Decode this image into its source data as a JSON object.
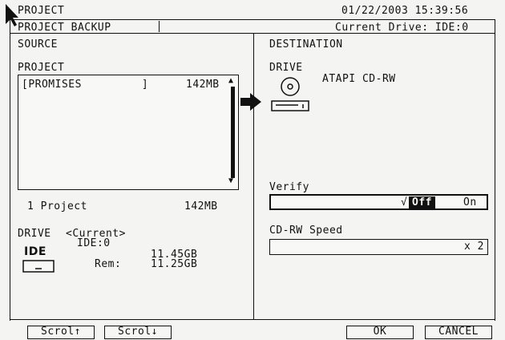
{
  "header": {
    "app_title": "PROJECT",
    "date_time": "01/22/2003 15:39:56",
    "screen_title": "PROJECT BACKUP",
    "current_drive": "Current Drive: IDE:0"
  },
  "source": {
    "heading": "SOURCE",
    "project_label": "PROJECT",
    "projects": [
      {
        "name": "[PROMISES         ]",
        "size": "142MB"
      }
    ],
    "count_label": "1 Project",
    "total_size": "142MB",
    "drive_label": "DRIVE",
    "drive_current": "<Current>",
    "drive_id": "IDE:0",
    "drive_icon_label": "IDE",
    "drive_capacity": "11.45GB",
    "rem_label": "Rem:",
    "rem_value": "11.25GB"
  },
  "destination": {
    "heading": "DESTINATION",
    "drive_label": "DRIVE",
    "drive_name": "ATAPI CD-RW",
    "verify_label": "Verify",
    "verify_check": "√",
    "verify_off": "Off",
    "verify_on": "On",
    "speed_label": "CD-RW Speed",
    "speed_value": "x 2"
  },
  "footer": {
    "scroll_up": "Scrol↑",
    "scroll_down": "Scrol↓",
    "ok": "OK",
    "cancel": "CANCEL"
  }
}
